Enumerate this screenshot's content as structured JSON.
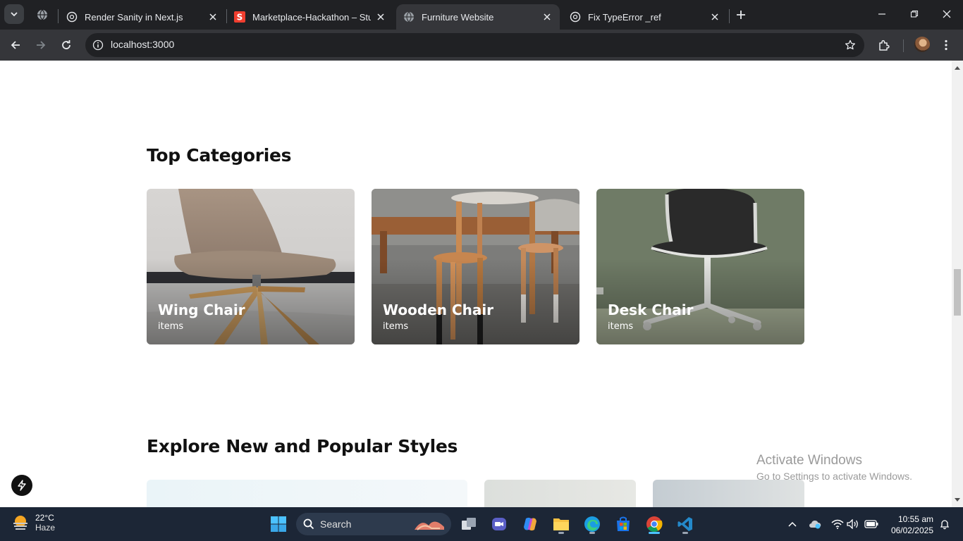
{
  "browser": {
    "tabs": [
      {
        "title": "Render Sanity in Next.js",
        "active": false,
        "favicon": "openai-icon"
      },
      {
        "title": "Marketplace-Hackathon – Studio",
        "active": false,
        "favicon": "sanity-icon"
      },
      {
        "title": "Furniture Website",
        "active": true,
        "favicon": "globe-icon"
      },
      {
        "title": "Fix TypeError _ref",
        "active": false,
        "favicon": "openai-icon"
      }
    ],
    "address": "localhost:3000"
  },
  "page": {
    "top_categories_title": "Top Categories",
    "categories": [
      {
        "name": "Wing Chair",
        "count": "items"
      },
      {
        "name": "Wooden Chair",
        "count": "items"
      },
      {
        "name": "Desk Chair",
        "count": "items"
      }
    ],
    "explore_title": "Explore New and Popular Styles"
  },
  "watermark": {
    "line1": "Activate Windows",
    "line2": "Go to Settings to activate Windows."
  },
  "taskbar": {
    "weather_temp": "22°C",
    "weather_cond": "Haze",
    "search_label": "Search",
    "time": "10:55 am",
    "date": "06/02/2025"
  },
  "colors": {
    "chrome_dark": "#202124",
    "chrome_toolbar": "#35363a",
    "taskbar": "#1c2636",
    "accent": "#4cc2ff"
  }
}
